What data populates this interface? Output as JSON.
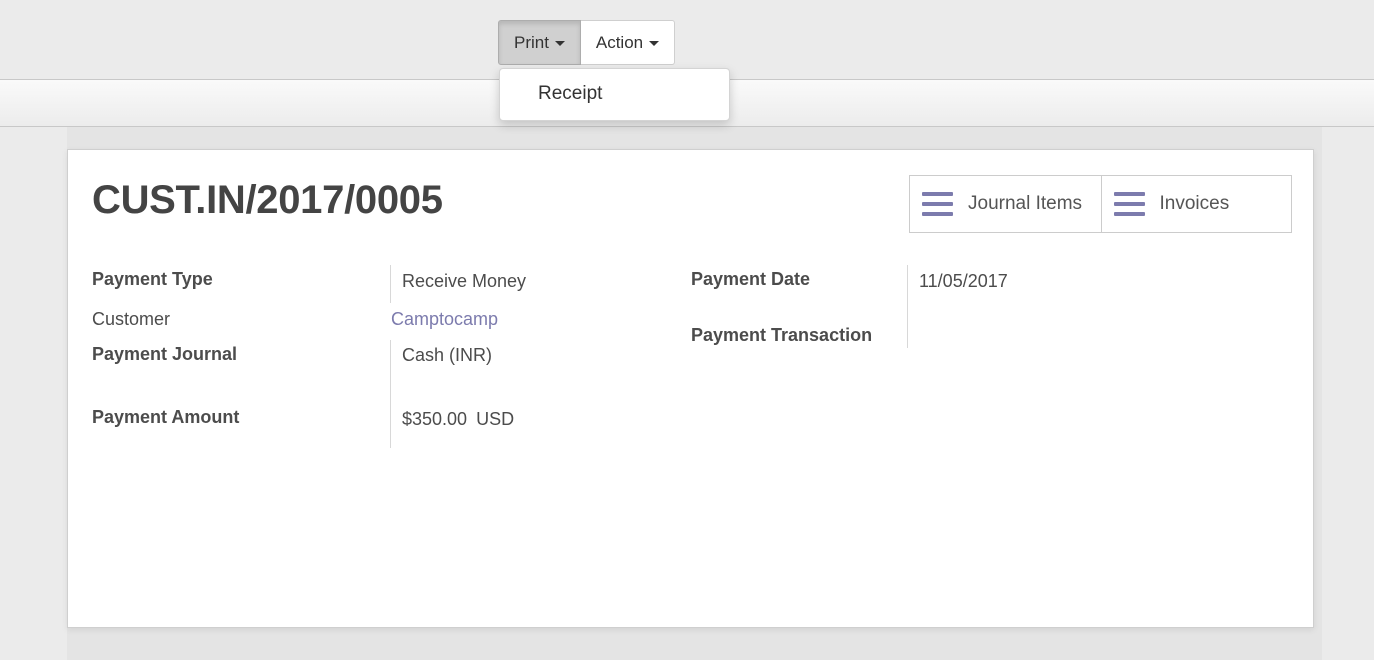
{
  "toolbar": {
    "print_label": "Print",
    "action_label": "Action",
    "print_menu": {
      "items": [
        {
          "label": "Receipt"
        }
      ]
    }
  },
  "record": {
    "title": "CUST.IN/2017/0005",
    "smart_buttons": [
      {
        "label": "Journal Items",
        "icon": "bars-icon"
      },
      {
        "label": "Invoices",
        "icon": "bars-icon"
      }
    ],
    "left_fields": {
      "payment_type": {
        "label": "Payment Type",
        "value": "Receive Money"
      },
      "customer": {
        "label": "Customer",
        "value": "Camptocamp"
      },
      "payment_journal": {
        "label": "Payment Journal",
        "value": "Cash (INR)"
      },
      "payment_amount": {
        "label": "Payment Amount",
        "value": "$350.00",
        "currency": "USD"
      }
    },
    "right_fields": {
      "payment_date": {
        "label": "Payment Date",
        "value": "11/05/2017"
      },
      "payment_transaction": {
        "label": "Payment Transaction",
        "value": ""
      }
    }
  },
  "colors": {
    "accent": "#7c7bad",
    "text": "#4c4c4c"
  }
}
